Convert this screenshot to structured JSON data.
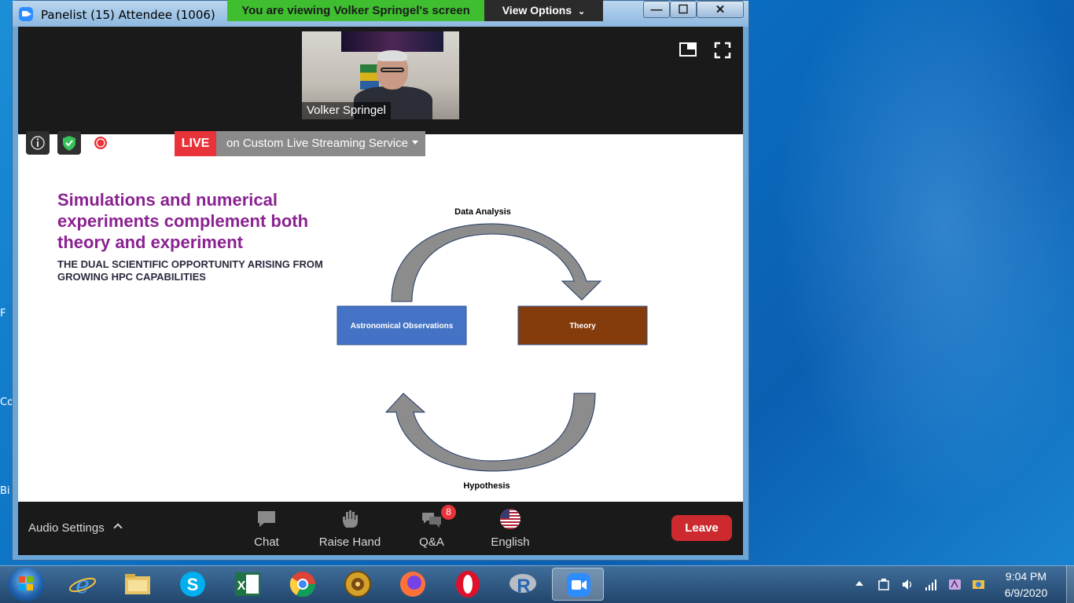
{
  "desktop": {
    "edge_labels": [
      "F",
      "Co",
      "Bi"
    ]
  },
  "window": {
    "title": "Panelist (15) Attendee (1006)",
    "controls": {
      "minimize": "—",
      "maximize": "☐",
      "close": "✕"
    }
  },
  "share_banner": {
    "text": "You are viewing Volker Springel's screen",
    "view_options": "View Options"
  },
  "speaker": {
    "name": "Volker Springel"
  },
  "live_stream": {
    "tag": "LIVE",
    "service": "on Custom Live Streaming Service"
  },
  "slide": {
    "title": "Simulations and numerical experiments complement both theory and experiment",
    "subtitle": "THE DUAL SCIENTIFIC OPPORTUNITY ARISING FROM GROWING HPC CAPABILITIES",
    "diagram": {
      "top_label": "Data Analysis",
      "bottom_label": "Hypothesis",
      "left_box": "Astronomical Observations",
      "right_box": "Theory",
      "colors": {
        "left_box": "#4472c4",
        "right_box": "#843c0c",
        "arrow": "#8c8c8c"
      }
    }
  },
  "toolbar": {
    "audio_settings": "Audio Settings",
    "chat": "Chat",
    "raise_hand": "Raise Hand",
    "qa": "Q&A",
    "qa_badge": "8",
    "language": "English",
    "leave": "Leave"
  },
  "taskbar": {
    "apps": [
      "internet-explorer",
      "file-explorer",
      "skype",
      "excel",
      "chrome",
      "unknown-app",
      "firefox",
      "opera",
      "r",
      "zoom"
    ],
    "time": "9:04 PM",
    "date": "6/9/2020"
  }
}
